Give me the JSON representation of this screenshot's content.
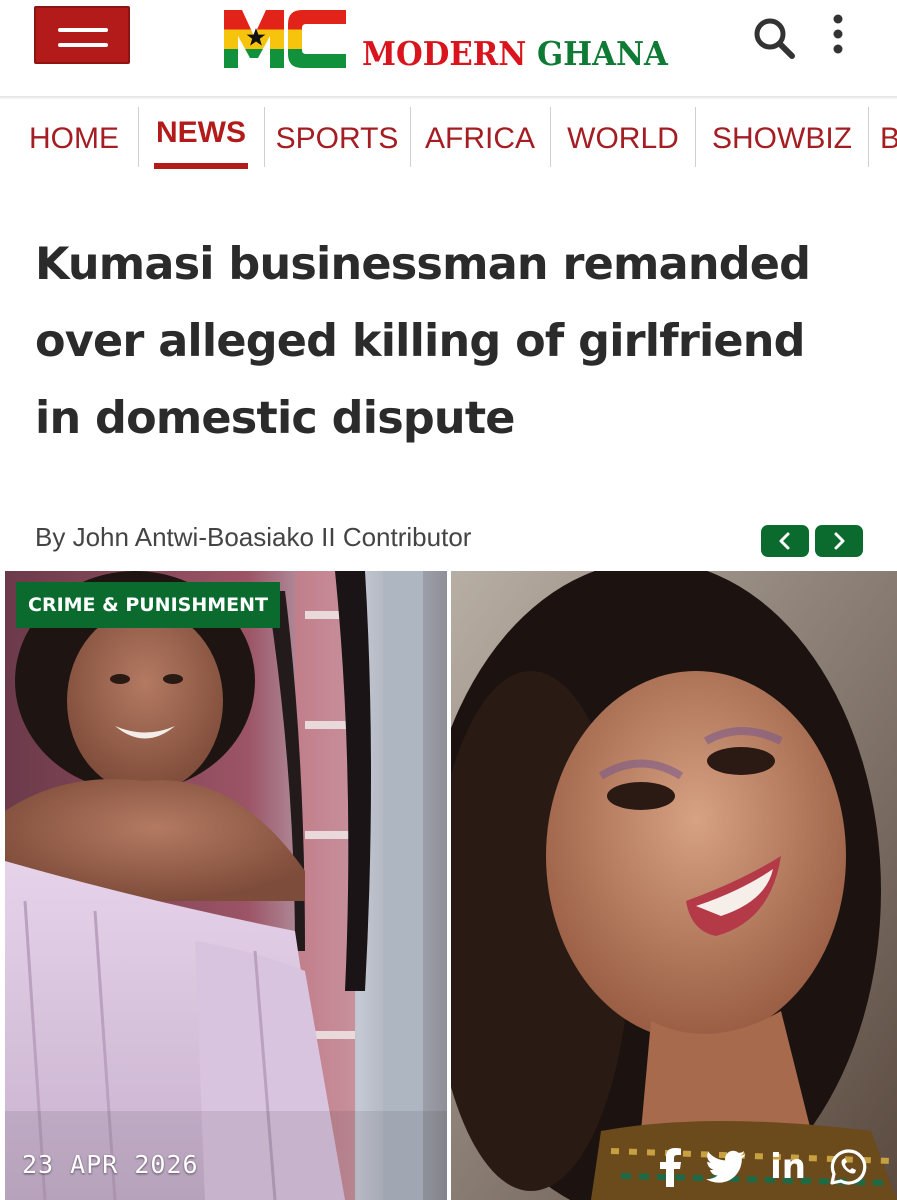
{
  "header": {
    "menu_icon": "hamburger-menu-icon",
    "logo": {
      "mark_letters": "MC",
      "word1": "MODERN",
      "word2": "GHANA"
    },
    "search_icon": "search-icon",
    "more_icon": "vertical-dots-icon"
  },
  "nav": {
    "items": [
      {
        "label": "HOME",
        "active": false
      },
      {
        "label": "NEWS",
        "active": true
      },
      {
        "label": "SPORTS",
        "active": false
      },
      {
        "label": "AFRICA",
        "active": false
      },
      {
        "label": "WORLD",
        "active": false
      },
      {
        "label": "SHOWBIZ",
        "active": false
      },
      {
        "label": "B",
        "active": false
      }
    ]
  },
  "article": {
    "headline_lines": [
      "Kumasi businessman remanded",
      "over alleged killing of girlfriend",
      "in domestic dispute"
    ],
    "byline": "By John Antwi-Boasiako II Contributor",
    "category": "CRIME & PUNISHMENT",
    "date": "23 APR 2026",
    "pager": {
      "prev_icon": "chevron-left-icon",
      "next_icon": "chevron-right-icon"
    },
    "share": {
      "facebook_icon": "facebook-icon",
      "twitter_icon": "twitter-icon",
      "linkedin_label": "in",
      "whatsapp_icon": "whatsapp-icon"
    }
  },
  "colors": {
    "brand_red": "#b31b1b",
    "brand_green": "#0b6b2f",
    "logo_red": "#d9141c",
    "logo_green": "#0e7a33",
    "ghana_gold": "#f6c40c",
    "headline_text": "#2b2b2b"
  }
}
